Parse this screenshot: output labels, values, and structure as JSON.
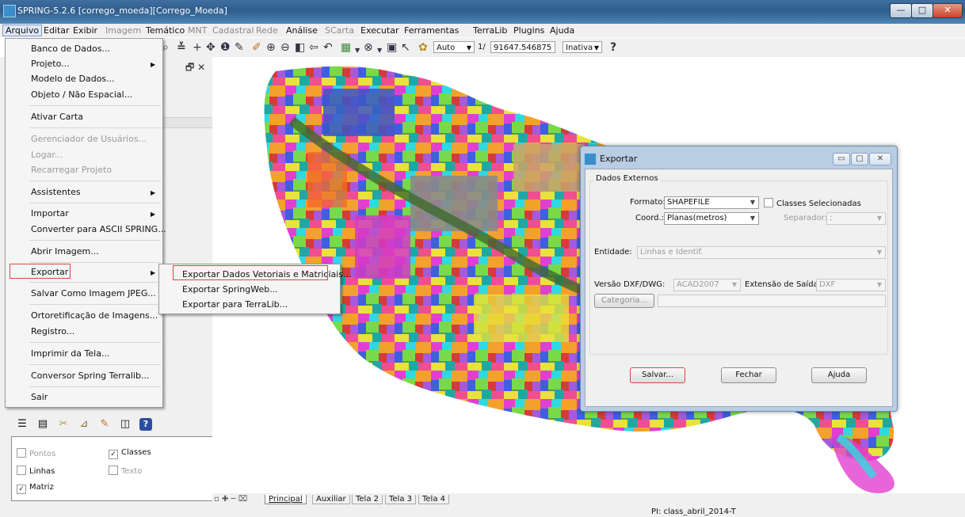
{
  "window": {
    "title": "SPRING-5.2.6 [corrego_moeda][Corrego_Moeda]",
    "min": "—",
    "max": "□",
    "close": "✕"
  },
  "menubar": {
    "items": [
      {
        "label": "Arquivo",
        "enabled": true
      },
      {
        "label": "Editar",
        "enabled": true
      },
      {
        "label": "Exibir",
        "enabled": true
      },
      {
        "label": "Imagem",
        "enabled": false
      },
      {
        "label": "Temático",
        "enabled": true
      },
      {
        "label": "MNT",
        "enabled": false
      },
      {
        "label": "Cadastral",
        "enabled": false
      },
      {
        "label": "Rede",
        "enabled": false
      },
      {
        "label": "Análise",
        "enabled": true
      },
      {
        "label": "SCarta",
        "enabled": false
      },
      {
        "label": "Executar",
        "enabled": true
      },
      {
        "label": "Ferramentas",
        "enabled": true
      },
      {
        "label": "TerraLib",
        "enabled": true
      },
      {
        "label": "Plugins",
        "enabled": true
      },
      {
        "label": "Ajuda",
        "enabled": true
      }
    ]
  },
  "toolbar": {
    "scale_mode": "Auto",
    "scale_prefix": "1/",
    "scale_value": "91647.546875",
    "state": "Inativa",
    "help": "?"
  },
  "arquivo_menu": {
    "items": [
      {
        "label": "Banco de Dados..."
      },
      {
        "label": "Projeto..."
      },
      {
        "label": "Modelo de Dados..."
      },
      {
        "label": "Objeto / Não Espacial..."
      },
      {
        "label": "Ativar Carta"
      },
      {
        "label": "Gerenciador de Usuários..."
      },
      {
        "label": "Logar..."
      },
      {
        "label": "Recarregar Projeto"
      },
      {
        "label": "Assistentes"
      },
      {
        "label": "Importar"
      },
      {
        "label": "Converter para ASCII SPRING..."
      },
      {
        "label": "Abrir Imagem..."
      },
      {
        "label": "Exportar"
      },
      {
        "label": "Salvar Como Imagem JPEG..."
      },
      {
        "label": "Ortoretificação de Imagens..."
      },
      {
        "label": "Registro..."
      },
      {
        "label": "Imprimir da Tela..."
      },
      {
        "label": "Conversor Spring Terralib..."
      },
      {
        "label": "Sair"
      }
    ]
  },
  "exportar_submenu": {
    "items": [
      {
        "label": "Exportar Dados Vetoriais e Matriciais..."
      },
      {
        "label": "Exportar SpringWeb..."
      },
      {
        "label": "Exportar para TerraLib..."
      }
    ]
  },
  "left_panel": {
    "checks": [
      {
        "label": "Pontos",
        "checked": false,
        "enabled": false
      },
      {
        "label": "Classes",
        "checked": true,
        "enabled": true
      },
      {
        "label": "Linhas",
        "checked": false,
        "enabled": true
      },
      {
        "label": "Texto",
        "checked": false,
        "enabled": false
      },
      {
        "label": "Matriz",
        "checked": true,
        "enabled": true
      }
    ]
  },
  "dialog": {
    "title": "Exportar",
    "group": "Dados Externos",
    "formato_label": "Formato:",
    "formato_value": "SHAPEFILE",
    "classes_label": "Classes Selecionadas",
    "coord_label": "Coord.:",
    "coord_value": "Planas(metros)",
    "separador_label": "Separador:",
    "separador_value": ";",
    "entidade_label": "Entidade:",
    "entidade_value": "Linhas e Identif.",
    "versao_label": "Versão DXF/DWG:",
    "versao_value": "ACAD2007",
    "extensao_label": "Extensão de Saída:",
    "extensao_value": "DXF",
    "categoria_label": "Categoria...",
    "salvar": "Salvar...",
    "fechar": "Fechar",
    "ajuda": "Ajuda"
  },
  "tabs": {
    "items": [
      "Principal",
      "Auxiliar",
      "Tela 2",
      "Tela 3",
      "Tela 4"
    ],
    "active": "Principal"
  },
  "status": {
    "text": "PI: class_abril_2014-T"
  }
}
